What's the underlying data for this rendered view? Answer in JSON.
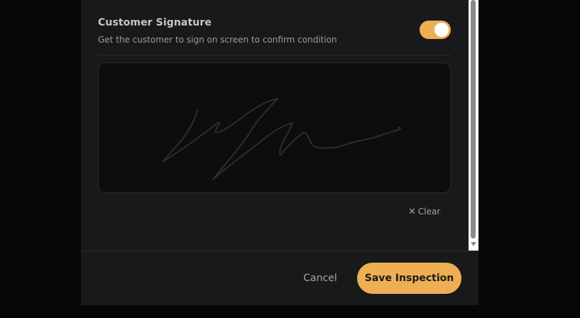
{
  "signature_section": {
    "title": "Customer Signature",
    "description": "Get the customer to sign on screen to confirm condition",
    "toggle_enabled": true
  },
  "signature_pad": {
    "clear_label": "Clear",
    "clear_icon": "close-icon"
  },
  "footer": {
    "cancel_label": "Cancel",
    "save_label": "Save Inspection"
  },
  "colors": {
    "accent": "#eeae53",
    "modal_bg": "#18191b",
    "pad_bg": "#0c0d0e"
  }
}
